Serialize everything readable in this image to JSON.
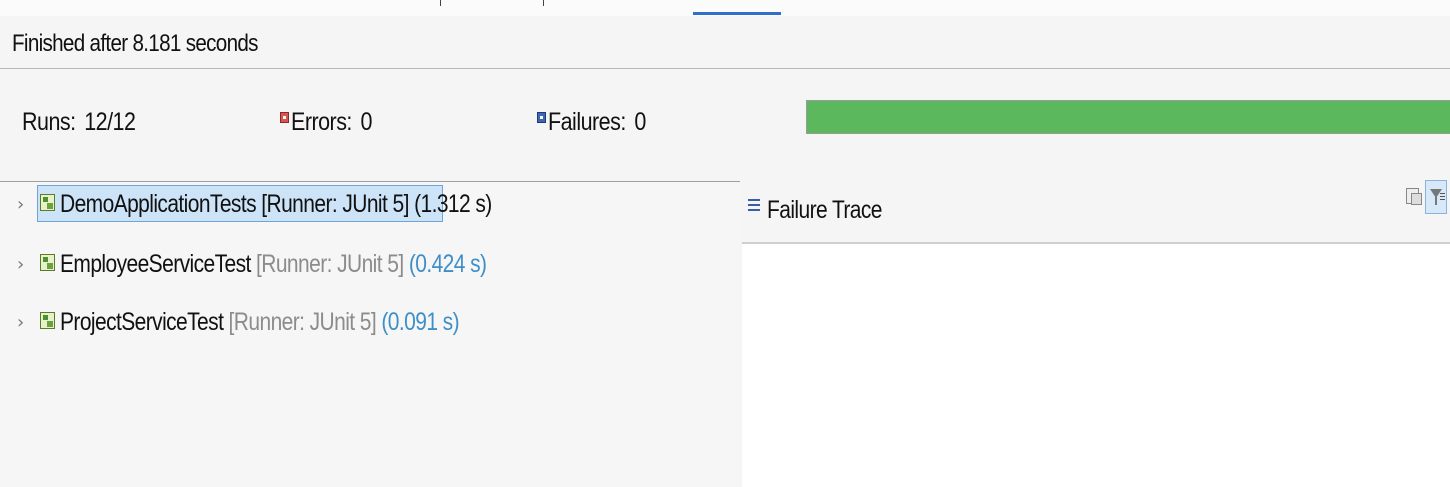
{
  "status": {
    "finished_text": "Finished after 8.181 seconds"
  },
  "counters": {
    "runs_label": "Runs:",
    "runs_value": "12/12",
    "errors_label": "Errors:",
    "errors_value": "0",
    "failures_label": "Failures:",
    "failures_value": "0"
  },
  "progress": {
    "fraction": 1.0,
    "color": "#5cb85c"
  },
  "tree": {
    "items": [
      {
        "name": "DemoApplicationTests",
        "runner": " [Runner: JUnit 5] ",
        "time": "(1.312 s)",
        "selected": true
      },
      {
        "name": "EmployeeServiceTest",
        "runner": " [Runner: JUnit 5] ",
        "time": "(0.424 s)",
        "selected": false
      },
      {
        "name": "ProjectServiceTest",
        "runner": " [Runner: JUnit 5] ",
        "time": "(0.091 s)",
        "selected": false
      }
    ],
    "icon": "test-suite-icon",
    "expand_icon": "chevron-right-icon"
  },
  "failure_trace": {
    "title": "Failure Trace",
    "icon": "stack-trace-icon",
    "tools": [
      "compare-results-icon",
      "filter-trace-icon"
    ]
  },
  "colors": {
    "time_text": "#3f8fc7",
    "selection_bg": "#cde3f7",
    "error_icon": "#d9534f",
    "failure_icon": "#3d66b5"
  }
}
